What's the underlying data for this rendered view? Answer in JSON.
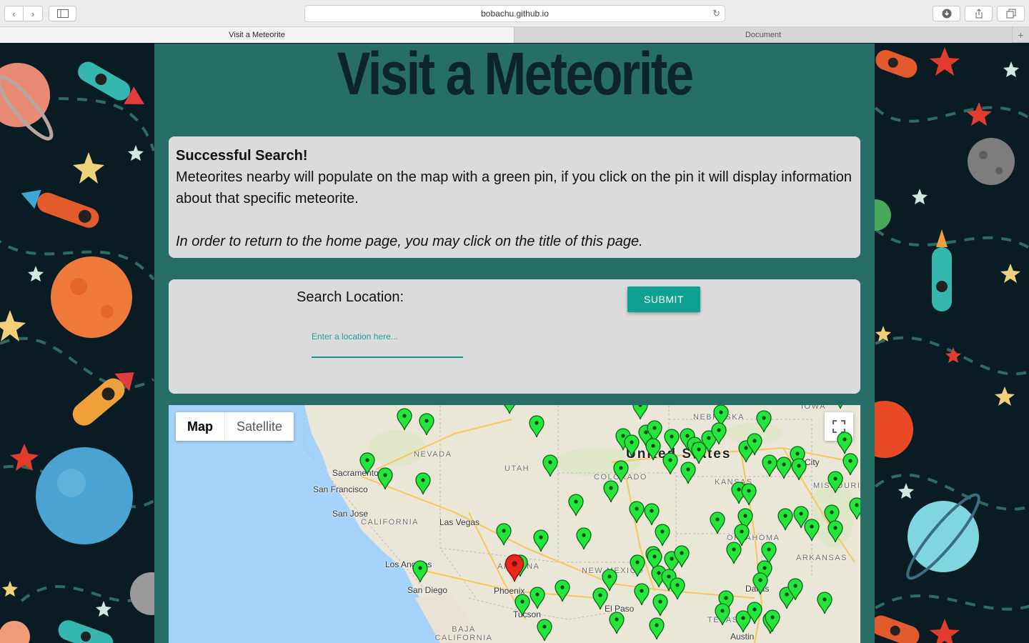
{
  "browser": {
    "url": "bobachu.github.io",
    "tabs": [
      {
        "label": "Visit a Meteorite",
        "active": true
      },
      {
        "label": "Document",
        "active": false
      }
    ]
  },
  "page": {
    "title": "Visit a Meteorite",
    "info": {
      "heading": "Successful Search!",
      "body": "Meteorites nearby will populate on the map with a green pin, if you click on the pin it will display information about that specific meteorite.",
      "note": "In order to return to the home page, you may click on the title of this page."
    },
    "search": {
      "label": "Search Location:",
      "placeholder": "Enter a location here...",
      "value": "",
      "submit_label": "SUBMIT"
    },
    "map": {
      "type_controls": [
        {
          "label": "Map",
          "selected": true
        },
        {
          "label": "Satellite",
          "selected": false
        }
      ],
      "labels": {
        "nevada": "NEVADA",
        "utah": "UTAH",
        "colorado": "COLORADO",
        "california": "CALIFORNIA",
        "nebraska": "NEBRASKA",
        "kansas": "KANSAS",
        "oklahoma": "OKLAHOMA",
        "arkansas": "ARKANSAS",
        "missouri": "MISSOURI",
        "new_mexico": "NEW MEXICO",
        "arizona": "ARIZONA",
        "texas": "TEXAS",
        "iowa": "IOWA",
        "baja_california": "BAJA CALIFORNIA",
        "united_states": "United States",
        "sacramento": "Sacramento",
        "san_francisco": "San Francisco",
        "san_jose": "San Jose",
        "las_vegas": "Las Vegas",
        "los_angeles": "Los Angeles",
        "san_diego": "San Diego",
        "phoenix": "Phoenix",
        "tucson": "Tucson",
        "el_paso": "El Paso",
        "dallas": "Dallas",
        "austin": "Austin",
        "kansas_city": "City"
      },
      "colors": {
        "meteorite_pin": "#22e63a",
        "selected_pin": "#e8281e",
        "water": "#a6d3fb",
        "land": "#eae6d8"
      }
    }
  }
}
